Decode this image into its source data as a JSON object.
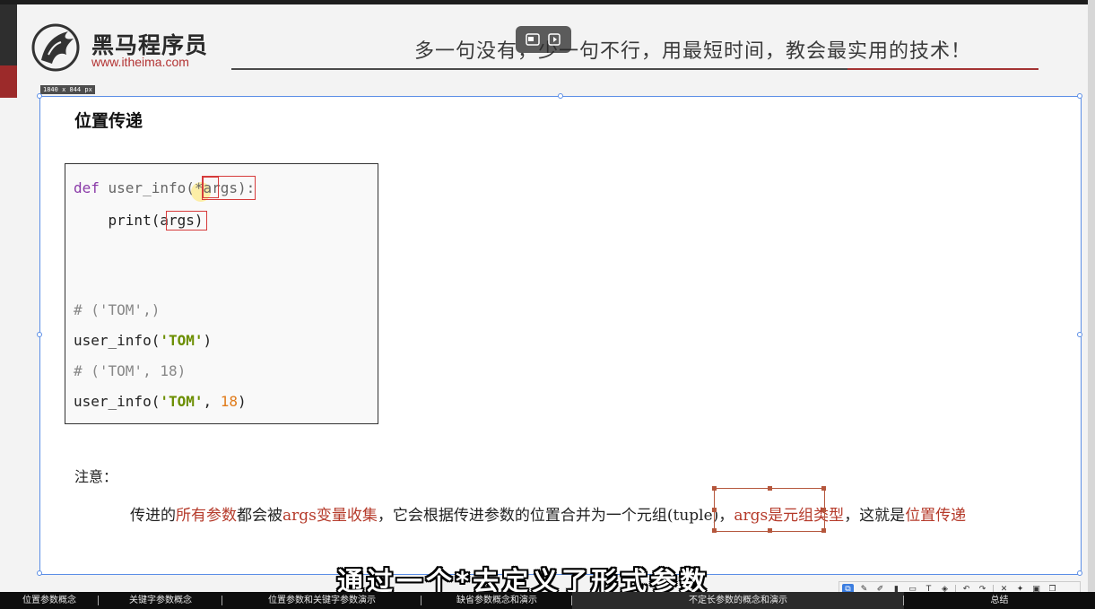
{
  "header": {
    "brand_name": "黑马程序员",
    "brand_url": "www.itheima.com",
    "slogan": "多一句没有，少一句不行，用最短时间，教会最实用的技术！"
  },
  "canvas": {
    "dimension_label": "1840 x 844  px"
  },
  "slide": {
    "section_title": "位置传递",
    "code_lines": [
      {
        "segments": [
          {
            "t": "def ",
            "c": "kw"
          },
          {
            "t": "user_info",
            "c": "fn"
          },
          {
            "t": "(*args)",
            "c": "fn"
          },
          {
            "t": ":",
            "c": "fn"
          }
        ]
      },
      {
        "segments": [
          {
            "t": "    print(args)",
            "c": ""
          }
        ]
      },
      {
        "segments": [
          {
            "t": "",
            "c": ""
          }
        ]
      },
      {
        "segments": [
          {
            "t": "",
            "c": ""
          }
        ]
      },
      {
        "segments": [
          {
            "t": "# ('TOM',)",
            "c": "cm"
          }
        ]
      },
      {
        "segments": [
          {
            "t": "user_info(",
            "c": ""
          },
          {
            "t": "'TOM'",
            "c": "str"
          },
          {
            "t": ")",
            "c": ""
          }
        ]
      },
      {
        "segments": [
          {
            "t": "# ('TOM', 18)",
            "c": "cm"
          }
        ]
      },
      {
        "segments": [
          {
            "t": "user_info(",
            "c": ""
          },
          {
            "t": "'TOM'",
            "c": "str"
          },
          {
            "t": ", ",
            "c": ""
          },
          {
            "t": "18",
            "c": "num"
          },
          {
            "t": ")",
            "c": ""
          }
        ]
      }
    ],
    "note_label": "注意：",
    "note_segments": [
      {
        "t": "传进的",
        "hl": false
      },
      {
        "t": "所有参数",
        "hl": true
      },
      {
        "t": "都会被",
        "hl": false
      },
      {
        "t": "args变量收集",
        "hl": true
      },
      {
        "t": "，它会根据传进参数的位置合并为一个元组(tuple)，",
        "hl": false
      },
      {
        "t": "args是元组类型",
        "hl": true
      },
      {
        "t": "，这就是",
        "hl": false
      },
      {
        "t": "位置传递",
        "hl": true
      }
    ]
  },
  "subtitle": "通过一个*去定义了形式参数",
  "toolbar_icons": [
    "select-icon",
    "pen-icon",
    "brush-icon",
    "marker-icon",
    "rect-icon",
    "text-icon",
    "eraser-icon",
    "sep",
    "undo-icon",
    "redo-icon",
    "sep",
    "close-icon",
    "pin-icon",
    "save-icon",
    "copy-icon"
  ],
  "chapters": [
    {
      "label": "位置参数概念",
      "active": false
    },
    {
      "label": "关键字参数概念",
      "active": false
    },
    {
      "label": "位置参数和关键字参数演示",
      "active": false
    },
    {
      "label": "缺省参数概念和演示",
      "active": false
    },
    {
      "label": "不定长参数的概念和演示",
      "active": true
    },
    {
      "label": "总结",
      "active": false
    }
  ],
  "colors": {
    "accent_red": "#b53a2a",
    "selection_blue": "#5b8ee6",
    "keyword_purple": "#8a3aa8",
    "string_green": "#6b8e00",
    "number_orange": "#e07b1a"
  }
}
